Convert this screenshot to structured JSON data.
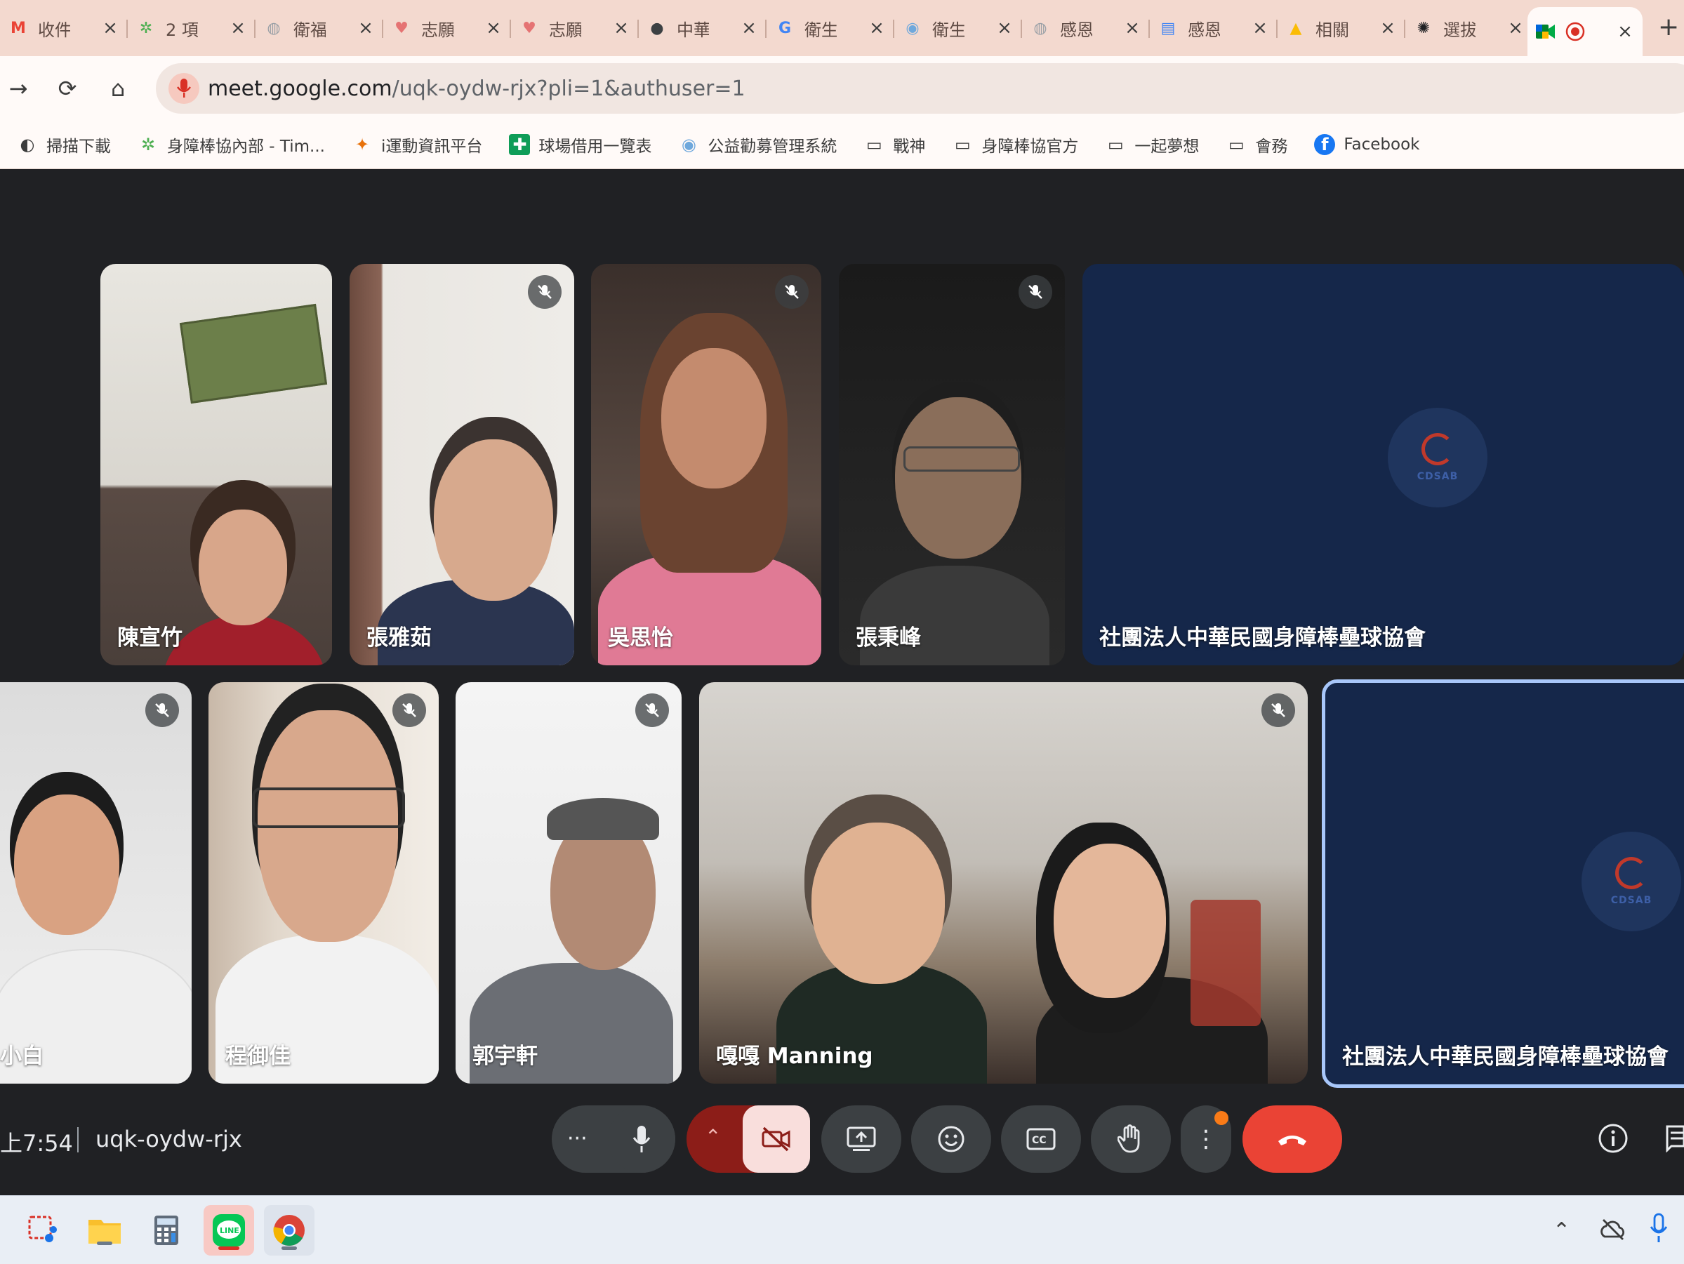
{
  "browser": {
    "tabs": [
      {
        "title": "收件",
        "icon": "gmail-icon",
        "glyph": "M",
        "color": "#ea4335"
      },
      {
        "title": "2 項",
        "icon": "leaf-icon",
        "glyph": "✲",
        "color": "#4caf50"
      },
      {
        "title": "衛福",
        "icon": "globe-icon",
        "glyph": "◍",
        "color": "#9aa0a6"
      },
      {
        "title": "志願",
        "icon": "heart-icon",
        "glyph": "♥",
        "color": "#e57373"
      },
      {
        "title": "志願",
        "icon": "heart-icon",
        "glyph": "♥",
        "color": "#e57373"
      },
      {
        "title": "中華",
        "icon": "emblem-icon",
        "glyph": "●",
        "color": "#3c4043"
      },
      {
        "title": "衛生",
        "icon": "google-icon",
        "glyph": "G",
        "color": "#4285f4"
      },
      {
        "title": "衛生",
        "icon": "seal-icon",
        "glyph": "◉",
        "color": "#6fa8dc"
      },
      {
        "title": "感恩",
        "icon": "globe-icon",
        "glyph": "◍",
        "color": "#9aa0a6"
      },
      {
        "title": "感恩",
        "icon": "docs-icon",
        "glyph": "▤",
        "color": "#4285f4"
      },
      {
        "title": "相關",
        "icon": "drive-icon",
        "glyph": "▲",
        "color": "#fbbc04"
      },
      {
        "title": "選拔",
        "icon": "openai-icon",
        "glyph": "✺",
        "color": "#202124"
      }
    ],
    "active_tab": {
      "icon": "meet-icon",
      "recording": "recording-icon"
    },
    "address": {
      "host": "meet.google.com",
      "path": "/uqk-oydw-rjx?pli=1&authuser=1"
    },
    "bookmarks": [
      {
        "label": "掃描下載",
        "icon": "globe-icon",
        "glyph": "◐"
      },
      {
        "label": "身障棒協內部 - Tim...",
        "icon": "leaf-icon",
        "glyph": "✲"
      },
      {
        "label": "i運動資訊平台",
        "icon": "sport-icon",
        "glyph": "✦"
      },
      {
        "label": "球場借用一覽表",
        "icon": "sheets-icon",
        "glyph": "✚"
      },
      {
        "label": "公益勸募管理系統",
        "icon": "seal-icon",
        "glyph": "◉"
      },
      {
        "label": "戰神",
        "icon": "folder-icon",
        "glyph": "▭"
      },
      {
        "label": "身障棒協官方",
        "icon": "folder-icon",
        "glyph": "▭"
      },
      {
        "label": "一起夢想",
        "icon": "folder-icon",
        "glyph": "▭"
      },
      {
        "label": "會務",
        "icon": "folder-icon",
        "glyph": "▭"
      },
      {
        "label": "Facebook",
        "icon": "facebook-icon",
        "glyph": "f"
      }
    ]
  },
  "meet": {
    "participants": [
      {
        "name": "陳宣竹",
        "muted": false
      },
      {
        "name": "張雅茹",
        "muted": true
      },
      {
        "name": "吳思怡",
        "muted": true
      },
      {
        "name": "張秉峰",
        "muted": true
      },
      {
        "name": "社團法人中華民國身障棒壘球協會",
        "muted": false,
        "logo": "CDSAB"
      },
      {
        "name": "小白",
        "muted": true
      },
      {
        "name": "程御佳",
        "muted": true
      },
      {
        "name": "郭宇軒",
        "muted": true
      },
      {
        "name": "嘎嘎 Manning",
        "muted": true
      },
      {
        "name": "社團法人中華民國身障棒壘球協會",
        "muted": false,
        "logo": "CDSAB"
      }
    ],
    "time": "上7:54",
    "code": "uqk-oydw-rjx"
  },
  "colors": {
    "accent_red": "#ea4335",
    "camera_off_bg": "#f9dedc",
    "camera_dark_red": "#8c1d18",
    "active_border": "#a8c7fa"
  }
}
